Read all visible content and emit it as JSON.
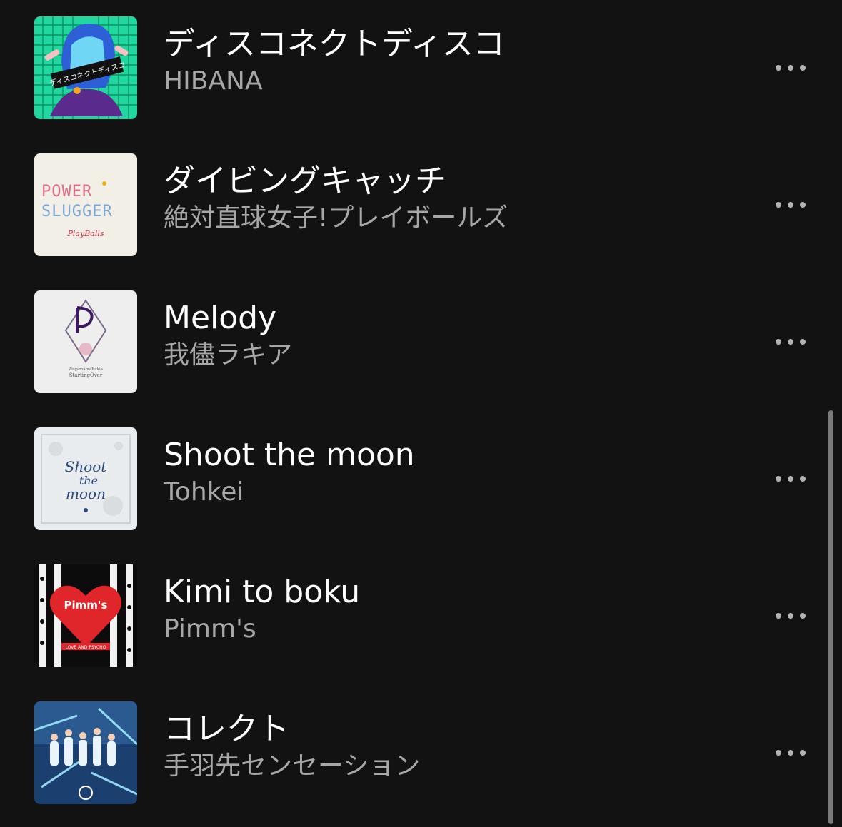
{
  "tracks": [
    {
      "title": "ディスコネクトディスコ",
      "artist": "HIBANA",
      "cover_text": "ディスコネクトディスコ",
      "more_icon": "more-horizontal-icon"
    },
    {
      "title": "ダイビングキャッチ",
      "artist": "絶対直球女子!プレイボールズ",
      "cover_text": "POWER SLUGGER",
      "cover_subtext": "PlayBalls",
      "more_icon": "more-horizontal-icon"
    },
    {
      "title": "Melody",
      "artist": "我儘ラキア",
      "cover_text": "StartingOver",
      "cover_subtext": "WagamamaRakia",
      "more_icon": "more-horizontal-icon"
    },
    {
      "title": "Shoot the moon",
      "artist": "Tohkei",
      "cover_text": "Shoot the moon",
      "more_icon": "more-horizontal-icon"
    },
    {
      "title": "Kimi to boku",
      "artist": "Pimm's",
      "cover_text": "Pimm's",
      "cover_subtext": "LOVE AND PSYCHO",
      "more_icon": "more-horizontal-icon"
    },
    {
      "title": "コレクト",
      "artist": "手羽先センセーション",
      "more_icon": "more-horizontal-icon"
    }
  ],
  "colors": {
    "background": "#121212",
    "title": "#ffffff",
    "subtitle": "#a7a7a7",
    "scrollbar": "#7a7a7a"
  }
}
